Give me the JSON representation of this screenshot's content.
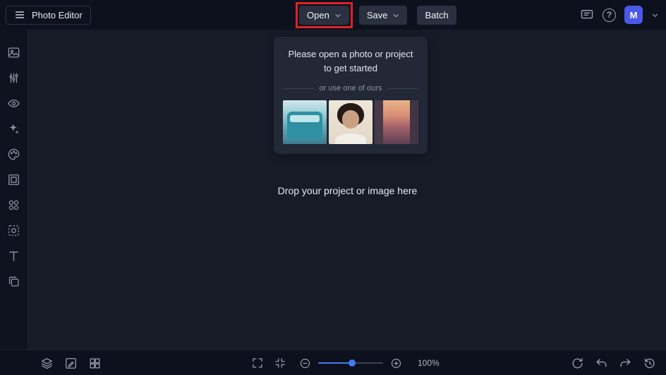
{
  "colors": {
    "accent_blue": "#3f7cf6",
    "avatar_bg": "#4b58e8",
    "annotation_red": "#df2127",
    "topbar_bg": "#0d111d",
    "canvas_bg": "#161b28",
    "panel_bg": "#222836"
  },
  "topbar": {
    "app_title": "Photo Editor",
    "open_label": "Open",
    "save_label": "Save",
    "batch_label": "Batch",
    "help_glyph": "?",
    "avatar_initial": "M"
  },
  "sidebar": {
    "tools": [
      "image-tool",
      "adjust-tool",
      "retouch-eye",
      "effects-sparkle",
      "paint-palette",
      "frame-tool",
      "elements-shapes",
      "cutout-mask",
      "text-tool",
      "duplicate-pages"
    ]
  },
  "welcome": {
    "title": "Please open a photo or project to get started",
    "subtitle": "or use one of ours",
    "samples": [
      "teal-van-photo",
      "portrait-photo",
      "canal-sunset-photo"
    ]
  },
  "canvas": {
    "drop_text": "Drop your project or image here"
  },
  "bottombar": {
    "zoom_level": "100%"
  }
}
